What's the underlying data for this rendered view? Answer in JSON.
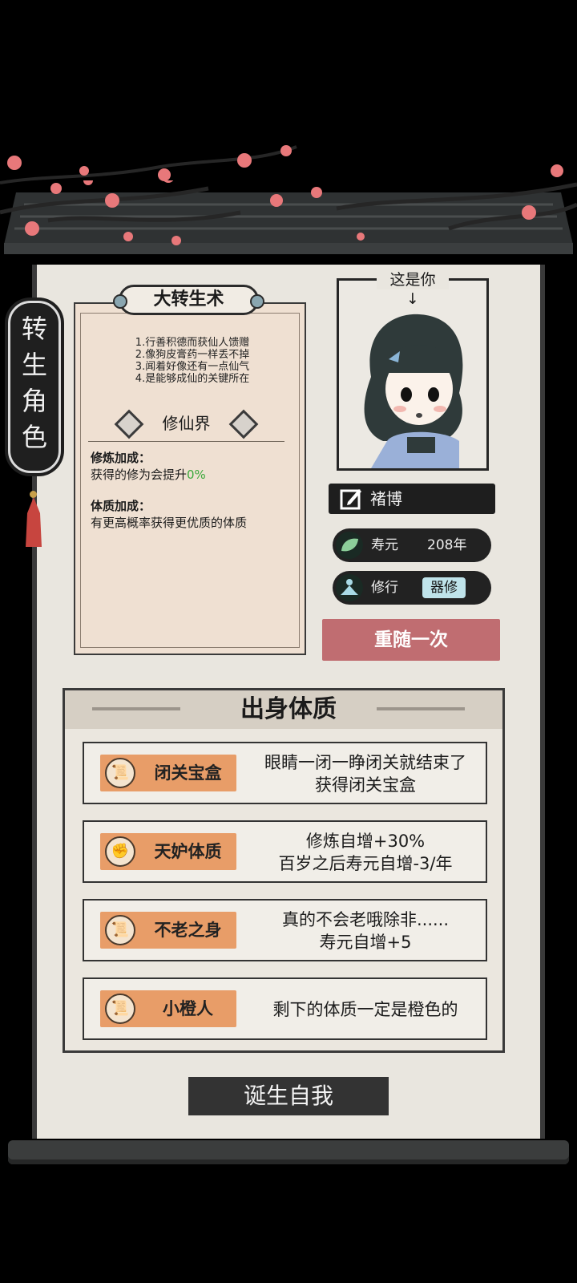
{
  "side_tag": {
    "chars": [
      "转",
      "生",
      "角",
      "色"
    ]
  },
  "card": {
    "title": "大转生术",
    "rules": [
      "1.行善积德而获仙人馈赠",
      "2.像狗皮膏药一样丢不掉",
      "3.闻着好像还有一点仙气",
      "4.是能够成仙的关键所在"
    ],
    "realm": "修仙界",
    "stat1_head": "修炼加成：",
    "stat1_text": "获得的修为会提升",
    "stat1_value": "0%",
    "stat2_head": "体质加成：",
    "stat2_text": "有更高概率获得更优质的体质"
  },
  "portrait": {
    "label": "这是你",
    "arrow": "↓"
  },
  "player": {
    "name": "褚博",
    "lifespan_label": "寿元",
    "lifespan_value": "208年",
    "cultivation_label": "修行",
    "cultivation_value": "器修"
  },
  "reroll_label": "重随一次",
  "origin": {
    "title": "出身体质",
    "traits": [
      {
        "name": "闭关宝盒",
        "icon": "scroll-icon",
        "desc1": "眼睛一闭一睁闭关就结束了",
        "desc2": "获得闭关宝盒"
      },
      {
        "name": "天妒体质",
        "icon": "fist-icon",
        "desc1": "修炼自增+30%",
        "desc2": "百岁之后寿元自增-3/年"
      },
      {
        "name": "不老之身",
        "icon": "scroll-icon",
        "desc1": "真的不会老哦除非......",
        "desc2": "寿元自增+5"
      },
      {
        "name": "小橙人",
        "icon": "scroll-icon",
        "desc1": "剩下的体质一定是橙色的",
        "desc2": ""
      }
    ]
  },
  "birth_label": "诞生自我",
  "colors": {
    "reroll": "#c06d71",
    "trait_tag": "#e89d68",
    "cultivation_tag": "#bfe3ea",
    "stat_value": "#3aa83a"
  }
}
